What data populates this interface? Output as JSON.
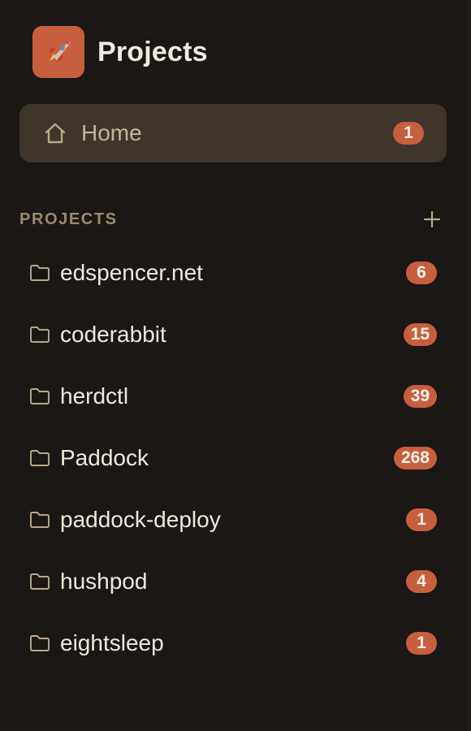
{
  "header": {
    "title": "Projects",
    "icon": "rocket-icon",
    "icon_bg": "#c75f3f"
  },
  "nav": {
    "home": {
      "label": "Home",
      "count": "1",
      "icon": "home-icon"
    }
  },
  "projects_section": {
    "label": "PROJECTS",
    "add_icon": "plus-icon"
  },
  "projects": [
    {
      "name": "edspencer.net",
      "count": "6"
    },
    {
      "name": "coderabbit",
      "count": "15"
    },
    {
      "name": "herdctl",
      "count": "39"
    },
    {
      "name": "Paddock",
      "count": "268"
    },
    {
      "name": "paddock-deploy",
      "count": "1"
    },
    {
      "name": "hushpod",
      "count": "4"
    },
    {
      "name": "eightsleep",
      "count": "1"
    }
  ],
  "colors": {
    "background": "#1b1715",
    "accent": "#c75f3f",
    "active_item_bg": "#40352b",
    "muted_text": "#9c8a70"
  }
}
